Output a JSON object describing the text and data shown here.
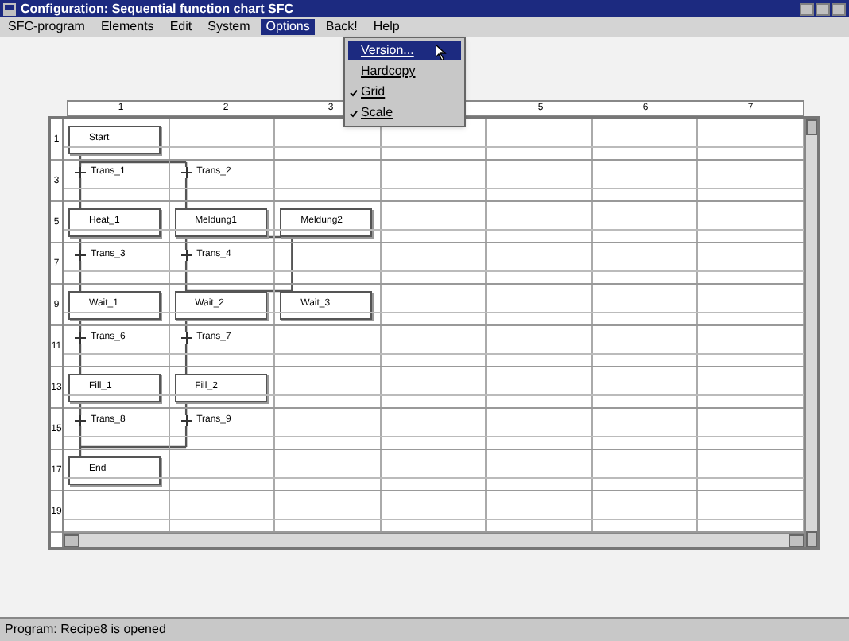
{
  "window": {
    "title": "Configuration: Sequential function chart SFC"
  },
  "menu_bar": [
    {
      "label": "SFC-program",
      "selected": false
    },
    {
      "label": "Elements",
      "selected": false
    },
    {
      "label": "Edit",
      "selected": false
    },
    {
      "label": "System",
      "selected": false
    },
    {
      "label": "Options",
      "selected": true
    },
    {
      "label": "Back!",
      "selected": false
    },
    {
      "label": "Help",
      "selected": false
    }
  ],
  "options_menu": [
    {
      "label": "Version...",
      "selected": true,
      "checked": false
    },
    {
      "label": "Hardcopy",
      "selected": false,
      "checked": false
    },
    {
      "label": "Grid",
      "selected": false,
      "checked": true
    },
    {
      "label": "Scale",
      "selected": false,
      "checked": true
    }
  ],
  "ruler": [
    "1",
    "2",
    "3",
    "5",
    "6",
    "7"
  ],
  "rows": [
    {
      "number": "1",
      "cells": [
        {
          "kind": "step",
          "label": "Start"
        }
      ]
    },
    {
      "number": "3",
      "cells": [
        {
          "kind": "transition",
          "label": "Trans_1"
        },
        {
          "kind": "transition",
          "label": "Trans_2"
        }
      ]
    },
    {
      "number": "5",
      "cells": [
        {
          "kind": "step",
          "label": "Heat_1"
        },
        {
          "kind": "step",
          "label": "Meldung1"
        },
        {
          "kind": "step",
          "label": "Meldung2"
        }
      ]
    },
    {
      "number": "7",
      "cells": [
        {
          "kind": "transition",
          "label": "Trans_3"
        },
        {
          "kind": "transition",
          "label": "Trans_4"
        }
      ]
    },
    {
      "number": "9",
      "cells": [
        {
          "kind": "step",
          "label": "Wait_1"
        },
        {
          "kind": "step",
          "label": "Wait_2"
        },
        {
          "kind": "step",
          "label": "Wait_3"
        }
      ]
    },
    {
      "number": "11",
      "cells": [
        {
          "kind": "transition",
          "label": "Trans_6"
        },
        {
          "kind": "transition",
          "label": "Trans_7"
        }
      ]
    },
    {
      "number": "13",
      "cells": [
        {
          "kind": "step",
          "label": "Fill_1"
        },
        {
          "kind": "step",
          "label": "Fill_2"
        }
      ]
    },
    {
      "number": "15",
      "cells": [
        {
          "kind": "transition",
          "label": "Trans_8"
        },
        {
          "kind": "transition",
          "label": "Trans_9"
        }
      ]
    },
    {
      "number": "17",
      "cells": [
        {
          "kind": "step",
          "label": "End"
        }
      ]
    },
    {
      "number": "19",
      "cells": []
    }
  ],
  "status_bar": "Program: Recipe8 is opened"
}
